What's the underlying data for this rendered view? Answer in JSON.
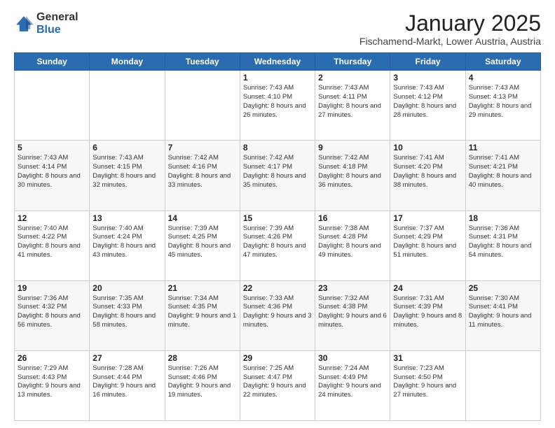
{
  "header": {
    "logo_general": "General",
    "logo_blue": "Blue",
    "month_title": "January 2025",
    "subtitle": "Fischamend-Markt, Lower Austria, Austria"
  },
  "weekdays": [
    "Sunday",
    "Monday",
    "Tuesday",
    "Wednesday",
    "Thursday",
    "Friday",
    "Saturday"
  ],
  "weeks": [
    [
      {
        "day": "",
        "info": ""
      },
      {
        "day": "",
        "info": ""
      },
      {
        "day": "",
        "info": ""
      },
      {
        "day": "1",
        "info": "Sunrise: 7:43 AM\nSunset: 4:10 PM\nDaylight: 8 hours\nand 26 minutes."
      },
      {
        "day": "2",
        "info": "Sunrise: 7:43 AM\nSunset: 4:11 PM\nDaylight: 8 hours\nand 27 minutes."
      },
      {
        "day": "3",
        "info": "Sunrise: 7:43 AM\nSunset: 4:12 PM\nDaylight: 8 hours\nand 28 minutes."
      },
      {
        "day": "4",
        "info": "Sunrise: 7:43 AM\nSunset: 4:13 PM\nDaylight: 8 hours\nand 29 minutes."
      }
    ],
    [
      {
        "day": "5",
        "info": "Sunrise: 7:43 AM\nSunset: 4:14 PM\nDaylight: 8 hours\nand 30 minutes."
      },
      {
        "day": "6",
        "info": "Sunrise: 7:43 AM\nSunset: 4:15 PM\nDaylight: 8 hours\nand 32 minutes."
      },
      {
        "day": "7",
        "info": "Sunrise: 7:42 AM\nSunset: 4:16 PM\nDaylight: 8 hours\nand 33 minutes."
      },
      {
        "day": "8",
        "info": "Sunrise: 7:42 AM\nSunset: 4:17 PM\nDaylight: 8 hours\nand 35 minutes."
      },
      {
        "day": "9",
        "info": "Sunrise: 7:42 AM\nSunset: 4:18 PM\nDaylight: 8 hours\nand 36 minutes."
      },
      {
        "day": "10",
        "info": "Sunrise: 7:41 AM\nSunset: 4:20 PM\nDaylight: 8 hours\nand 38 minutes."
      },
      {
        "day": "11",
        "info": "Sunrise: 7:41 AM\nSunset: 4:21 PM\nDaylight: 8 hours\nand 40 minutes."
      }
    ],
    [
      {
        "day": "12",
        "info": "Sunrise: 7:40 AM\nSunset: 4:22 PM\nDaylight: 8 hours\nand 41 minutes."
      },
      {
        "day": "13",
        "info": "Sunrise: 7:40 AM\nSunset: 4:24 PM\nDaylight: 8 hours\nand 43 minutes."
      },
      {
        "day": "14",
        "info": "Sunrise: 7:39 AM\nSunset: 4:25 PM\nDaylight: 8 hours\nand 45 minutes."
      },
      {
        "day": "15",
        "info": "Sunrise: 7:39 AM\nSunset: 4:26 PM\nDaylight: 8 hours\nand 47 minutes."
      },
      {
        "day": "16",
        "info": "Sunrise: 7:38 AM\nSunset: 4:28 PM\nDaylight: 8 hours\nand 49 minutes."
      },
      {
        "day": "17",
        "info": "Sunrise: 7:37 AM\nSunset: 4:29 PM\nDaylight: 8 hours\nand 51 minutes."
      },
      {
        "day": "18",
        "info": "Sunrise: 7:36 AM\nSunset: 4:31 PM\nDaylight: 8 hours\nand 54 minutes."
      }
    ],
    [
      {
        "day": "19",
        "info": "Sunrise: 7:36 AM\nSunset: 4:32 PM\nDaylight: 8 hours\nand 56 minutes."
      },
      {
        "day": "20",
        "info": "Sunrise: 7:35 AM\nSunset: 4:33 PM\nDaylight: 8 hours\nand 58 minutes."
      },
      {
        "day": "21",
        "info": "Sunrise: 7:34 AM\nSunset: 4:35 PM\nDaylight: 9 hours\nand 1 minute."
      },
      {
        "day": "22",
        "info": "Sunrise: 7:33 AM\nSunset: 4:36 PM\nDaylight: 9 hours\nand 3 minutes."
      },
      {
        "day": "23",
        "info": "Sunrise: 7:32 AM\nSunset: 4:38 PM\nDaylight: 9 hours\nand 6 minutes."
      },
      {
        "day": "24",
        "info": "Sunrise: 7:31 AM\nSunset: 4:39 PM\nDaylight: 9 hours\nand 8 minutes."
      },
      {
        "day": "25",
        "info": "Sunrise: 7:30 AM\nSunset: 4:41 PM\nDaylight: 9 hours\nand 11 minutes."
      }
    ],
    [
      {
        "day": "26",
        "info": "Sunrise: 7:29 AM\nSunset: 4:43 PM\nDaylight: 9 hours\nand 13 minutes."
      },
      {
        "day": "27",
        "info": "Sunrise: 7:28 AM\nSunset: 4:44 PM\nDaylight: 9 hours\nand 16 minutes."
      },
      {
        "day": "28",
        "info": "Sunrise: 7:26 AM\nSunset: 4:46 PM\nDaylight: 9 hours\nand 19 minutes."
      },
      {
        "day": "29",
        "info": "Sunrise: 7:25 AM\nSunset: 4:47 PM\nDaylight: 9 hours\nand 22 minutes."
      },
      {
        "day": "30",
        "info": "Sunrise: 7:24 AM\nSunset: 4:49 PM\nDaylight: 9 hours\nand 24 minutes."
      },
      {
        "day": "31",
        "info": "Sunrise: 7:23 AM\nSunset: 4:50 PM\nDaylight: 9 hours\nand 27 minutes."
      },
      {
        "day": "",
        "info": ""
      }
    ]
  ]
}
